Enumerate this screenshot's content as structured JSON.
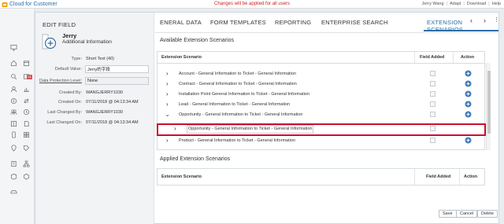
{
  "topbar": {
    "brand": "Cloud for Customer",
    "notice": "Changes will be applied for all users",
    "menu": [
      "Jerry Wang",
      "Adapt",
      "Download",
      "Help"
    ]
  },
  "shell": {
    "badge_count": "11"
  },
  "edit_panel": {
    "title": "EDIT FIELD",
    "field_name": "Jerry",
    "field_subtitle": "Additional Information",
    "props": {
      "type_label": "Type:",
      "type_value": "Short Text (40)",
      "default_label": "Default Value:",
      "default_value": "Jerry的字段",
      "dp_label": "Data Protection Level:",
      "dp_value": "None",
      "created_by_label": "Created By:",
      "created_by_value": "WANGJERRY1030",
      "created_on_label": "Created On:",
      "created_on_value": "07/11/2018 @ 04:13:34 AM",
      "changed_by_label": "Last Changed By:",
      "changed_by_value": "WANGJERRY1030",
      "changed_on_label": "Last Changed On:",
      "changed_on_value": "07/11/2018 @ 04:13:34 AM"
    }
  },
  "tabs": [
    {
      "label": "ENERAL DATA"
    },
    {
      "label": "FORM TEMPLATES"
    },
    {
      "label": "REPORTING"
    },
    {
      "label": "ENTERPRISE SEARCH"
    },
    {
      "label": "EXTENSION SCENARIOS"
    }
  ],
  "available": {
    "title": "Available Extension Scenarios",
    "headers": {
      "scenario": "Extension Scenario",
      "added": "Field Added",
      "action": "Action"
    },
    "rows": [
      {
        "name": "Account - General Information to Ticket - General Information",
        "expanded": false
      },
      {
        "name": "Contract - General Information to Ticket - General Information",
        "expanded": false
      },
      {
        "name": "Installation Point General Information to Ticket - General Information",
        "expanded": false
      },
      {
        "name": "Lead - General Information to Ticket - General Information",
        "expanded": false
      },
      {
        "name": "Opportunity - General Information to Ticket - General Information",
        "expanded": true
      },
      {
        "name": "Opportunity - General Information to Ticket - General Information",
        "expanded": false,
        "child": true
      },
      {
        "name": "Product - General Information to Ticket - General Information",
        "expanded": false
      }
    ]
  },
  "applied": {
    "title": "Applied Extension Scenarios",
    "headers": {
      "scenario": "Extension Scenario",
      "added": "Field Added",
      "action": "Action"
    }
  },
  "footer": {
    "save": "Save",
    "cancel": "Cancel",
    "delete": "Delete"
  },
  "colors": {
    "accent": "#2b6ea8",
    "notice": "#d11f1f",
    "highlight": "#c8102e"
  }
}
